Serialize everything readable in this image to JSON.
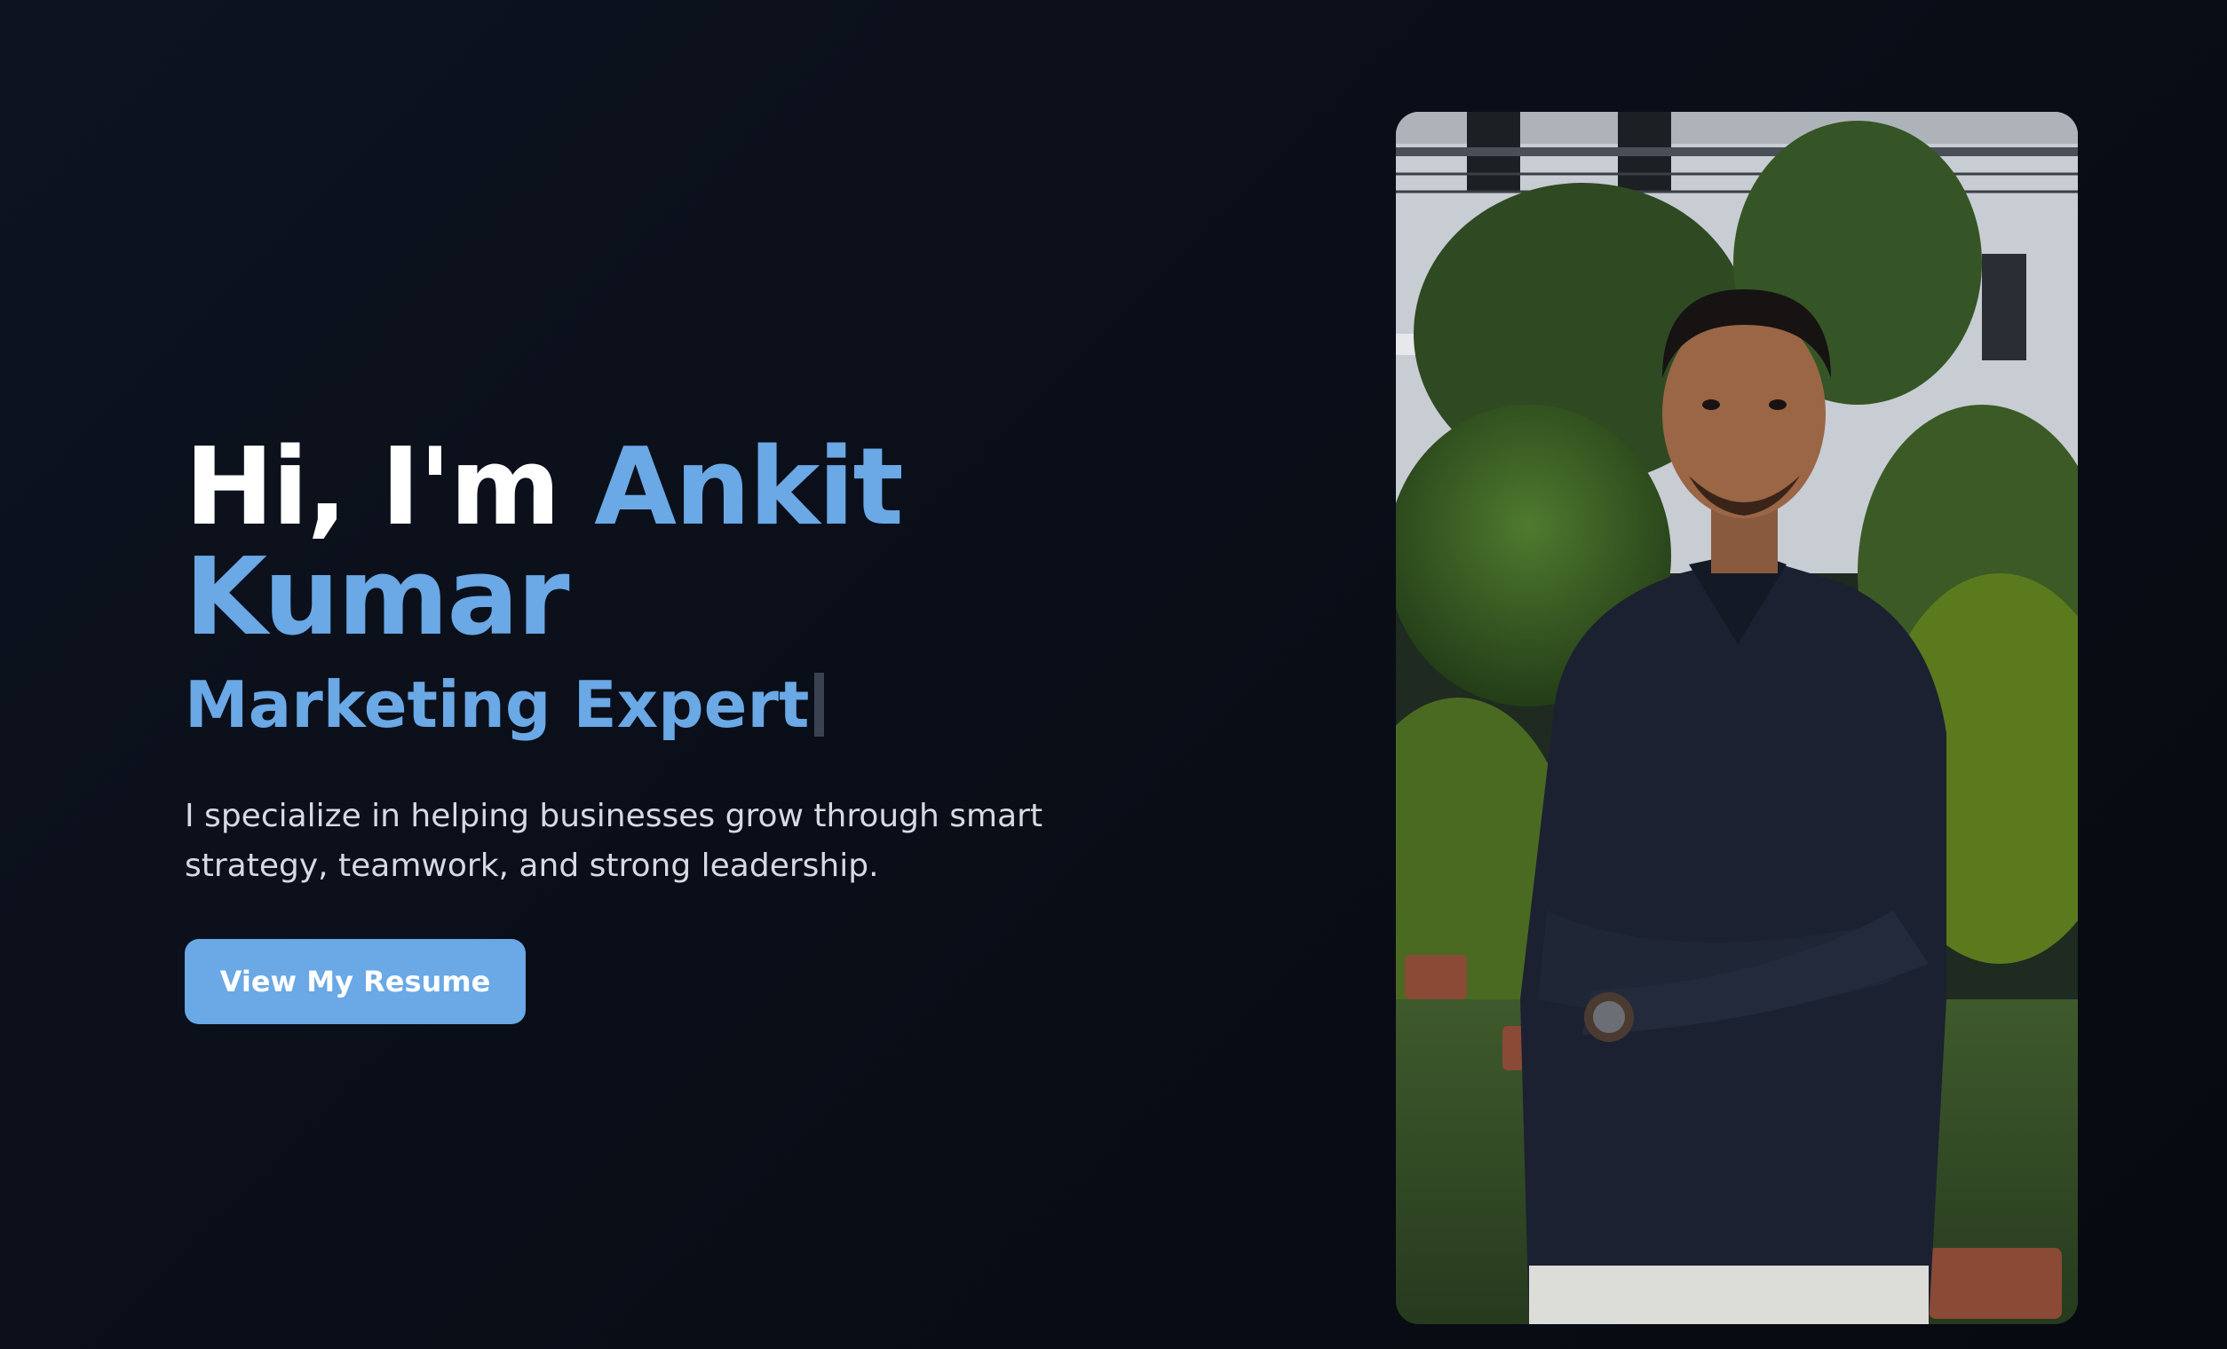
{
  "hero": {
    "greeting": "Hi, I'm ",
    "name": "Ankit Kumar",
    "role": "Marketing Expert",
    "description": "I specialize in helping businesses grow through smart strategy, teamwork, and strong leadership.",
    "button_label": "View My Resume"
  },
  "colors": {
    "accent": "#6aa8e6",
    "background": "#0a0e18",
    "text": "#ffffff"
  }
}
